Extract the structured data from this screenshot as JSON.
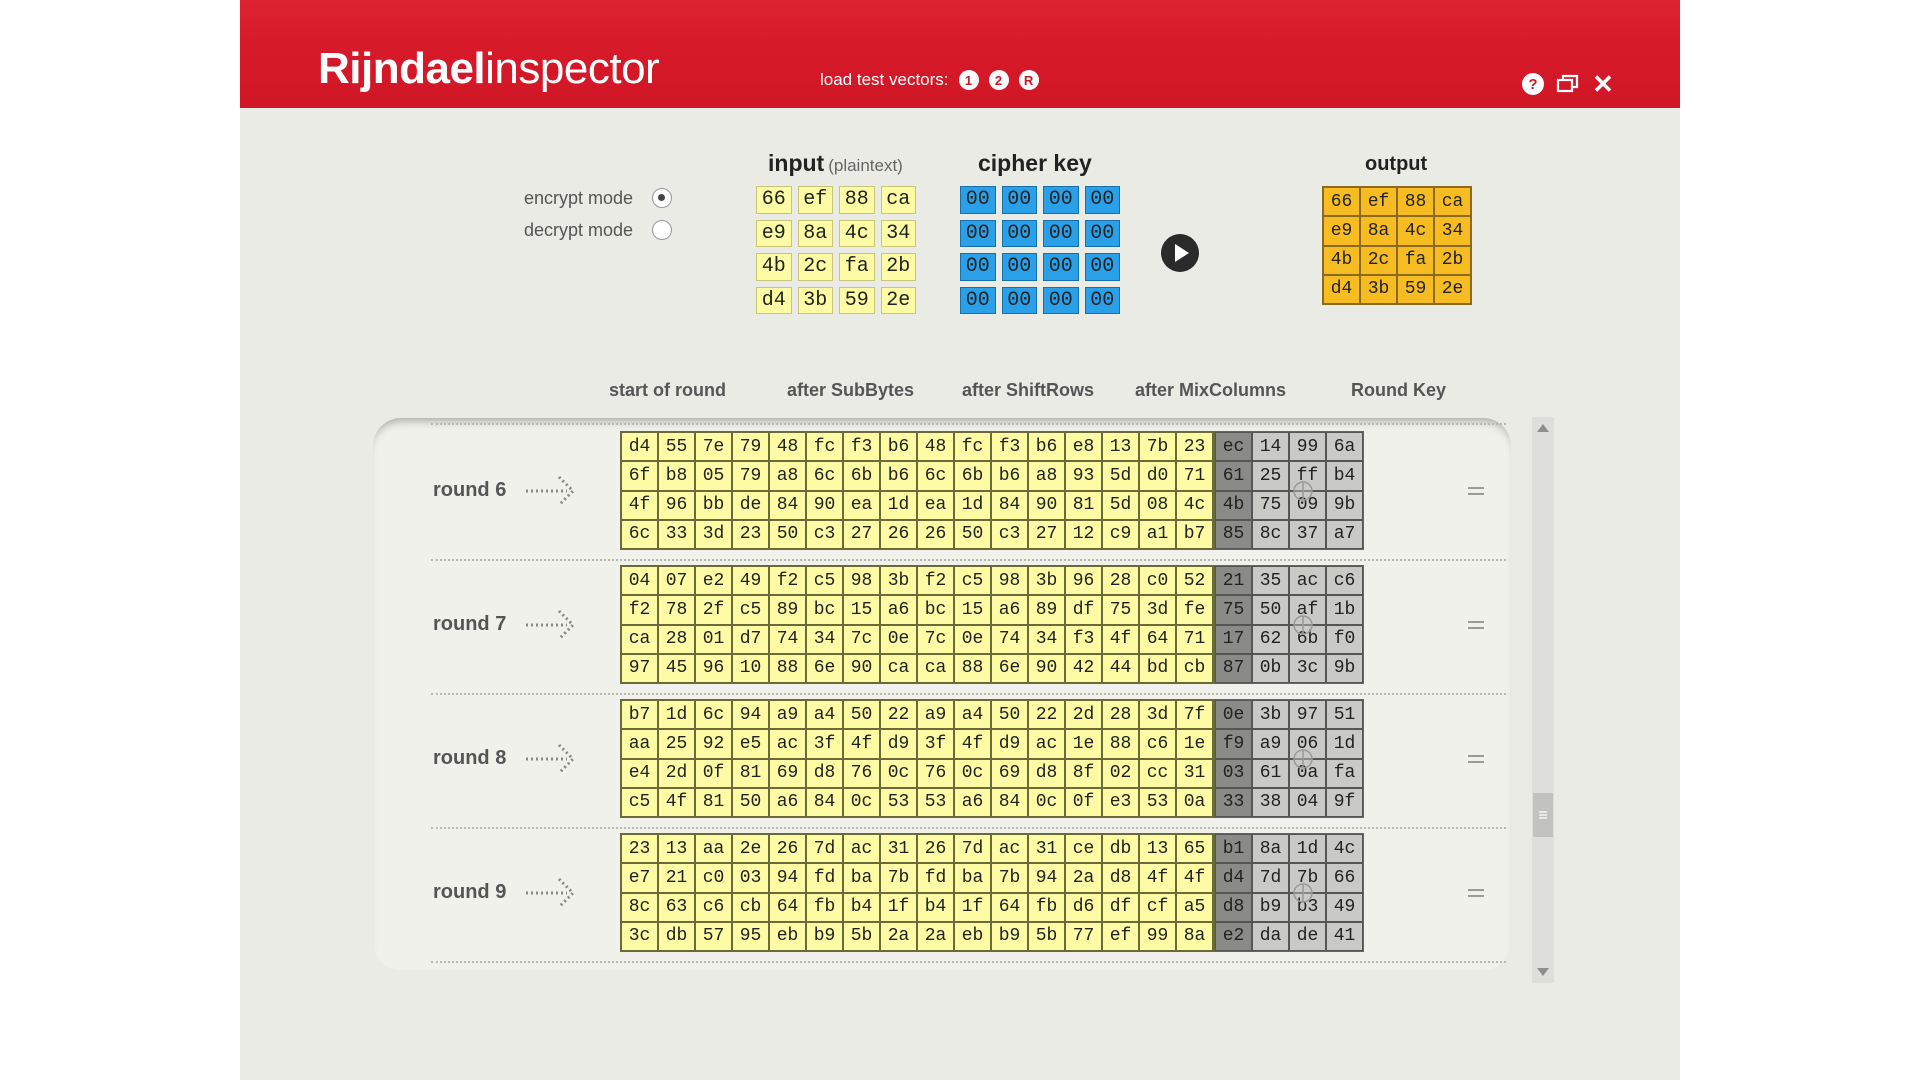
{
  "header": {
    "title_bold": "Rijndael",
    "title_light": "inspector",
    "load_label": "load test vectors:",
    "vector_buttons": [
      "1",
      "2",
      "R"
    ],
    "help_icon": "?",
    "close_icon": "✕"
  },
  "mode": {
    "encrypt_label": "encrypt mode",
    "decrypt_label": "decrypt mode",
    "selected": "encrypt"
  },
  "input": {
    "title": "input",
    "subtitle": "(plaintext)",
    "matrix": [
      [
        "66",
        "ef",
        "88",
        "ca"
      ],
      [
        "e9",
        "8a",
        "4c",
        "34"
      ],
      [
        "4b",
        "2c",
        "fa",
        "2b"
      ],
      [
        "d4",
        "3b",
        "59",
        "2e"
      ]
    ]
  },
  "cipher_key": {
    "title": "cipher key",
    "matrix": [
      [
        "00",
        "00",
        "00",
        "00"
      ],
      [
        "00",
        "00",
        "00",
        "00"
      ],
      [
        "00",
        "00",
        "00",
        "00"
      ],
      [
        "00",
        "00",
        "00",
        "00"
      ]
    ]
  },
  "output": {
    "title": "output",
    "matrix": [
      [
        "66",
        "ef",
        "88",
        "ca"
      ],
      [
        "e9",
        "8a",
        "4c",
        "34"
      ],
      [
        "4b",
        "2c",
        "fa",
        "2b"
      ],
      [
        "d4",
        "3b",
        "59",
        "2e"
      ]
    ]
  },
  "columns": [
    "start of round",
    "after SubBytes",
    "after ShiftRows",
    "after MixColumns",
    "Round Key"
  ],
  "rounds": [
    {
      "label": "round 6",
      "start": [
        [
          "d4",
          "55",
          "7e",
          "79"
        ],
        [
          "6f",
          "b8",
          "05",
          "79"
        ],
        [
          "4f",
          "96",
          "bb",
          "de"
        ],
        [
          "6c",
          "33",
          "3d",
          "23"
        ]
      ],
      "sub": [
        [
          "48",
          "fc",
          "f3",
          "b6"
        ],
        [
          "a8",
          "6c",
          "6b",
          "b6"
        ],
        [
          "84",
          "90",
          "ea",
          "1d"
        ],
        [
          "50",
          "c3",
          "27",
          "26"
        ]
      ],
      "shift": [
        [
          "48",
          "fc",
          "f3",
          "b6"
        ],
        [
          "6c",
          "6b",
          "b6",
          "a8"
        ],
        [
          "ea",
          "1d",
          "84",
          "90"
        ],
        [
          "26",
          "50",
          "c3",
          "27"
        ]
      ],
      "mix": [
        [
          "e8",
          "13",
          "7b",
          "23"
        ],
        [
          "93",
          "5d",
          "d0",
          "71"
        ],
        [
          "81",
          "5d",
          "08",
          "4c"
        ],
        [
          "12",
          "c9",
          "a1",
          "b7"
        ]
      ],
      "key": [
        [
          "ec",
          "14",
          "99",
          "6a"
        ],
        [
          "61",
          "25",
          "ff",
          "b4"
        ],
        [
          "4b",
          "75",
          "09",
          "9b"
        ],
        [
          "85",
          "8c",
          "37",
          "a7"
        ]
      ]
    },
    {
      "label": "round 7",
      "start": [
        [
          "04",
          "07",
          "e2",
          "49"
        ],
        [
          "f2",
          "78",
          "2f",
          "c5"
        ],
        [
          "ca",
          "28",
          "01",
          "d7"
        ],
        [
          "97",
          "45",
          "96",
          "10"
        ]
      ],
      "sub": [
        [
          "f2",
          "c5",
          "98",
          "3b"
        ],
        [
          "89",
          "bc",
          "15",
          "a6"
        ],
        [
          "74",
          "34",
          "7c",
          "0e"
        ],
        [
          "88",
          "6e",
          "90",
          "ca"
        ]
      ],
      "shift": [
        [
          "f2",
          "c5",
          "98",
          "3b"
        ],
        [
          "bc",
          "15",
          "a6",
          "89"
        ],
        [
          "7c",
          "0e",
          "74",
          "34"
        ],
        [
          "ca",
          "88",
          "6e",
          "90"
        ]
      ],
      "mix": [
        [
          "96",
          "28",
          "c0",
          "52"
        ],
        [
          "df",
          "75",
          "3d",
          "fe"
        ],
        [
          "f3",
          "4f",
          "64",
          "71"
        ],
        [
          "42",
          "44",
          "bd",
          "cb"
        ]
      ],
      "key": [
        [
          "21",
          "35",
          "ac",
          "c6"
        ],
        [
          "75",
          "50",
          "af",
          "1b"
        ],
        [
          "17",
          "62",
          "6b",
          "f0"
        ],
        [
          "87",
          "0b",
          "3c",
          "9b"
        ]
      ]
    },
    {
      "label": "round 8",
      "start": [
        [
          "b7",
          "1d",
          "6c",
          "94"
        ],
        [
          "aa",
          "25",
          "92",
          "e5"
        ],
        [
          "e4",
          "2d",
          "0f",
          "81"
        ],
        [
          "c5",
          "4f",
          "81",
          "50"
        ]
      ],
      "sub": [
        [
          "a9",
          "a4",
          "50",
          "22"
        ],
        [
          "ac",
          "3f",
          "4f",
          "d9"
        ],
        [
          "69",
          "d8",
          "76",
          "0c"
        ],
        [
          "a6",
          "84",
          "0c",
          "53"
        ]
      ],
      "shift": [
        [
          "a9",
          "a4",
          "50",
          "22"
        ],
        [
          "3f",
          "4f",
          "d9",
          "ac"
        ],
        [
          "76",
          "0c",
          "69",
          "d8"
        ],
        [
          "53",
          "a6",
          "84",
          "0c"
        ]
      ],
      "mix": [
        [
          "2d",
          "28",
          "3d",
          "7f"
        ],
        [
          "1e",
          "88",
          "c6",
          "1e"
        ],
        [
          "8f",
          "02",
          "cc",
          "31"
        ],
        [
          "0f",
          "e3",
          "53",
          "0a"
        ]
      ],
      "key": [
        [
          "0e",
          "3b",
          "97",
          "51"
        ],
        [
          "f9",
          "a9",
          "06",
          "1d"
        ],
        [
          "03",
          "61",
          "0a",
          "fa"
        ],
        [
          "33",
          "38",
          "04",
          "9f"
        ]
      ]
    },
    {
      "label": "round 9",
      "start": [
        [
          "23",
          "13",
          "aa",
          "2e"
        ],
        [
          "e7",
          "21",
          "c0",
          "03"
        ],
        [
          "8c",
          "63",
          "c6",
          "cb"
        ],
        [
          "3c",
          "db",
          "57",
          "95"
        ]
      ],
      "sub": [
        [
          "26",
          "7d",
          "ac",
          "31"
        ],
        [
          "94",
          "fd",
          "ba",
          "7b"
        ],
        [
          "64",
          "fb",
          "b4",
          "1f"
        ],
        [
          "eb",
          "b9",
          "5b",
          "2a"
        ]
      ],
      "shift": [
        [
          "26",
          "7d",
          "ac",
          "31"
        ],
        [
          "fd",
          "ba",
          "7b",
          "94"
        ],
        [
          "b4",
          "1f",
          "64",
          "fb"
        ],
        [
          "2a",
          "eb",
          "b9",
          "5b"
        ]
      ],
      "mix": [
        [
          "ce",
          "db",
          "13",
          "65"
        ],
        [
          "2a",
          "d8",
          "4f",
          "4f"
        ],
        [
          "d6",
          "df",
          "cf",
          "a5"
        ],
        [
          "77",
          "ef",
          "99",
          "8a"
        ]
      ],
      "key": [
        [
          "b1",
          "8a",
          "1d",
          "4c"
        ],
        [
          "d4",
          "7d",
          "7b",
          "66"
        ],
        [
          "d8",
          "b9",
          "b3",
          "49"
        ],
        [
          "e2",
          "da",
          "de",
          "41"
        ]
      ]
    }
  ],
  "colors": {
    "header_red": "#d71a2a",
    "state_yellow": "#fdfca4",
    "key_blue": "#29a0e8",
    "output_orange": "#f6bc22",
    "round_key_gray": "#c9c9c6",
    "round_key_first_col": "#8a8a88"
  }
}
